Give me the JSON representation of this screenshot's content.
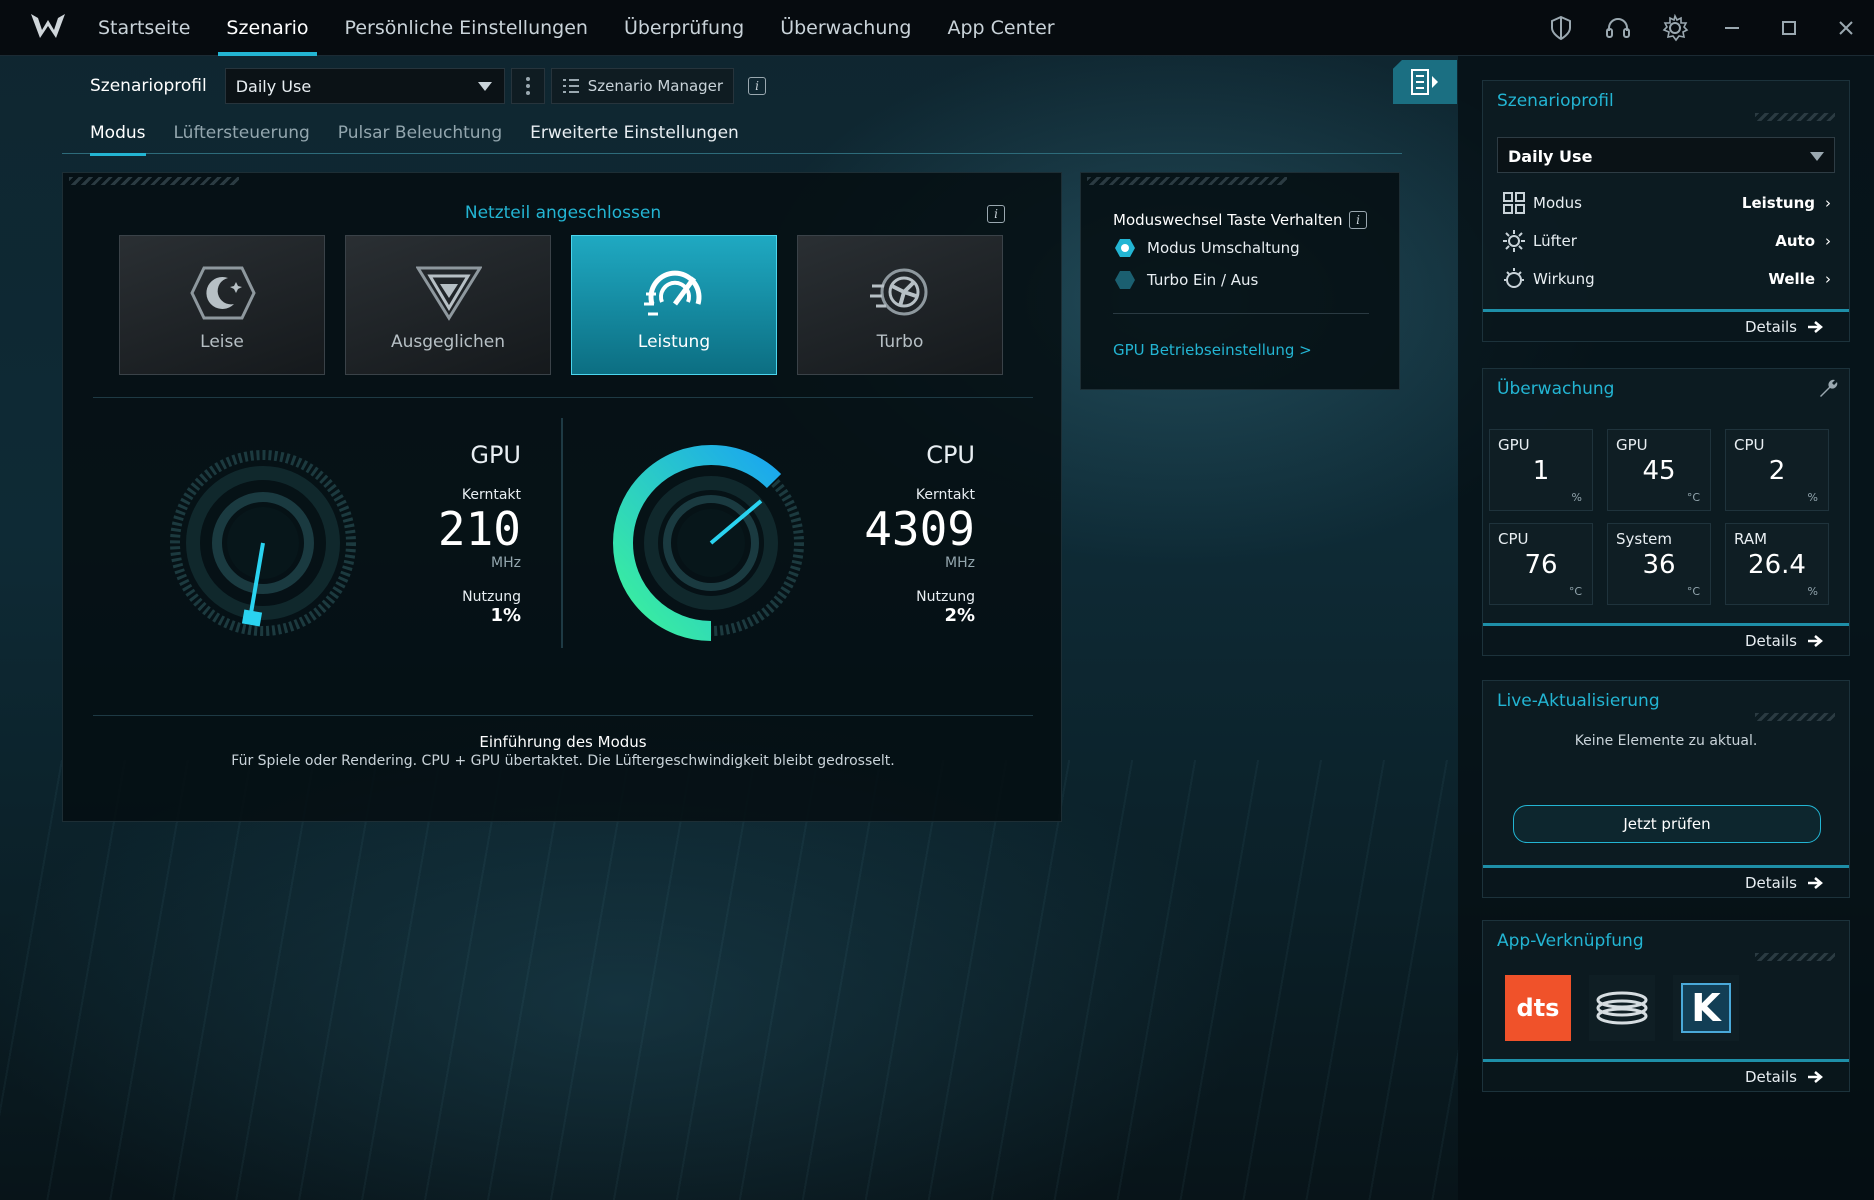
{
  "nav": {
    "tabs": [
      "Startseite",
      "Szenario",
      "Persönliche Einstellungen",
      "Überprüfung",
      "Überwachung",
      "App Center"
    ],
    "active": 1
  },
  "profile": {
    "label": "Szenarioprofil",
    "selected": "Daily Use",
    "manager_label": "Szenario Manager"
  },
  "subtabs": [
    "Modus",
    "Lüftersteuerung",
    "Pulsar Beleuchtung",
    "Erweiterte Einstellungen"
  ],
  "modus": {
    "power_status": "Netzteil angeschlossen",
    "modes": [
      {
        "label": "Leise",
        "icon": "moon-icon"
      },
      {
        "label": "Ausgeglichen",
        "icon": "balance-icon"
      },
      {
        "label": "Leistung",
        "icon": "speedometer-icon"
      },
      {
        "label": "Turbo",
        "icon": "turbo-fan-icon"
      }
    ],
    "active_mode": 2,
    "gpu": {
      "title": "GPU",
      "clock_label": "Kerntakt",
      "clock": "210",
      "clock_unit": "MHz",
      "usage_label": "Nutzung",
      "usage": "1%",
      "usage_value": 1
    },
    "cpu": {
      "title": "CPU",
      "clock_label": "Kerntakt",
      "clock": "4309",
      "clock_unit": "MHz",
      "usage_label": "Nutzung",
      "usage": "2%",
      "usage_value": 2
    },
    "intro_title": "Einführung des Modus",
    "intro_text": "Für Spiele oder Rendering. CPU + GPU übertaktet. Die Lüftergeschwindigkeit bleibt gedrosselt."
  },
  "switch_panel": {
    "title": "Moduswechsel Taste Verhalten",
    "options": [
      "Modus Umschaltung",
      "Turbo Ein / Aus"
    ],
    "selected": 0,
    "gpu_link": "GPU Betriebseinstellung >"
  },
  "sidebar": {
    "profile_card": {
      "title": "Szenarioprofil",
      "selected": "Daily Use",
      "rows": [
        {
          "label": "Modus",
          "value": "Leistung",
          "icon": "modus-grid-icon"
        },
        {
          "label": "Lüfter",
          "value": "Auto",
          "icon": "fan-icon"
        },
        {
          "label": "Wirkung",
          "value": "Welle",
          "icon": "light-effect-icon"
        }
      ],
      "details": "Details"
    },
    "monitor_card": {
      "title": "Überwachung",
      "tiles": [
        {
          "label": "GPU",
          "value": "1",
          "unit": "%"
        },
        {
          "label": "GPU",
          "value": "45",
          "unit": "°C"
        },
        {
          "label": "CPU",
          "value": "2",
          "unit": "%"
        },
        {
          "label": "CPU",
          "value": "76",
          "unit": "°C"
        },
        {
          "label": "System",
          "value": "36",
          "unit": "°C"
        },
        {
          "label": "RAM",
          "value": "26.4",
          "unit": "%"
        }
      ],
      "details": "Details"
    },
    "live_card": {
      "title": "Live-Aktualisierung",
      "message": "Keine Elemente zu aktual.",
      "button": "Jetzt prüfen",
      "details": "Details"
    },
    "app_card": {
      "title": "App-Verknüpfung",
      "apps": [
        "dts",
        "k"
      ],
      "details": "Details"
    }
  },
  "colors": {
    "accent": "#23b5d3",
    "panel": "#050e12",
    "dts": "#f0522a"
  }
}
